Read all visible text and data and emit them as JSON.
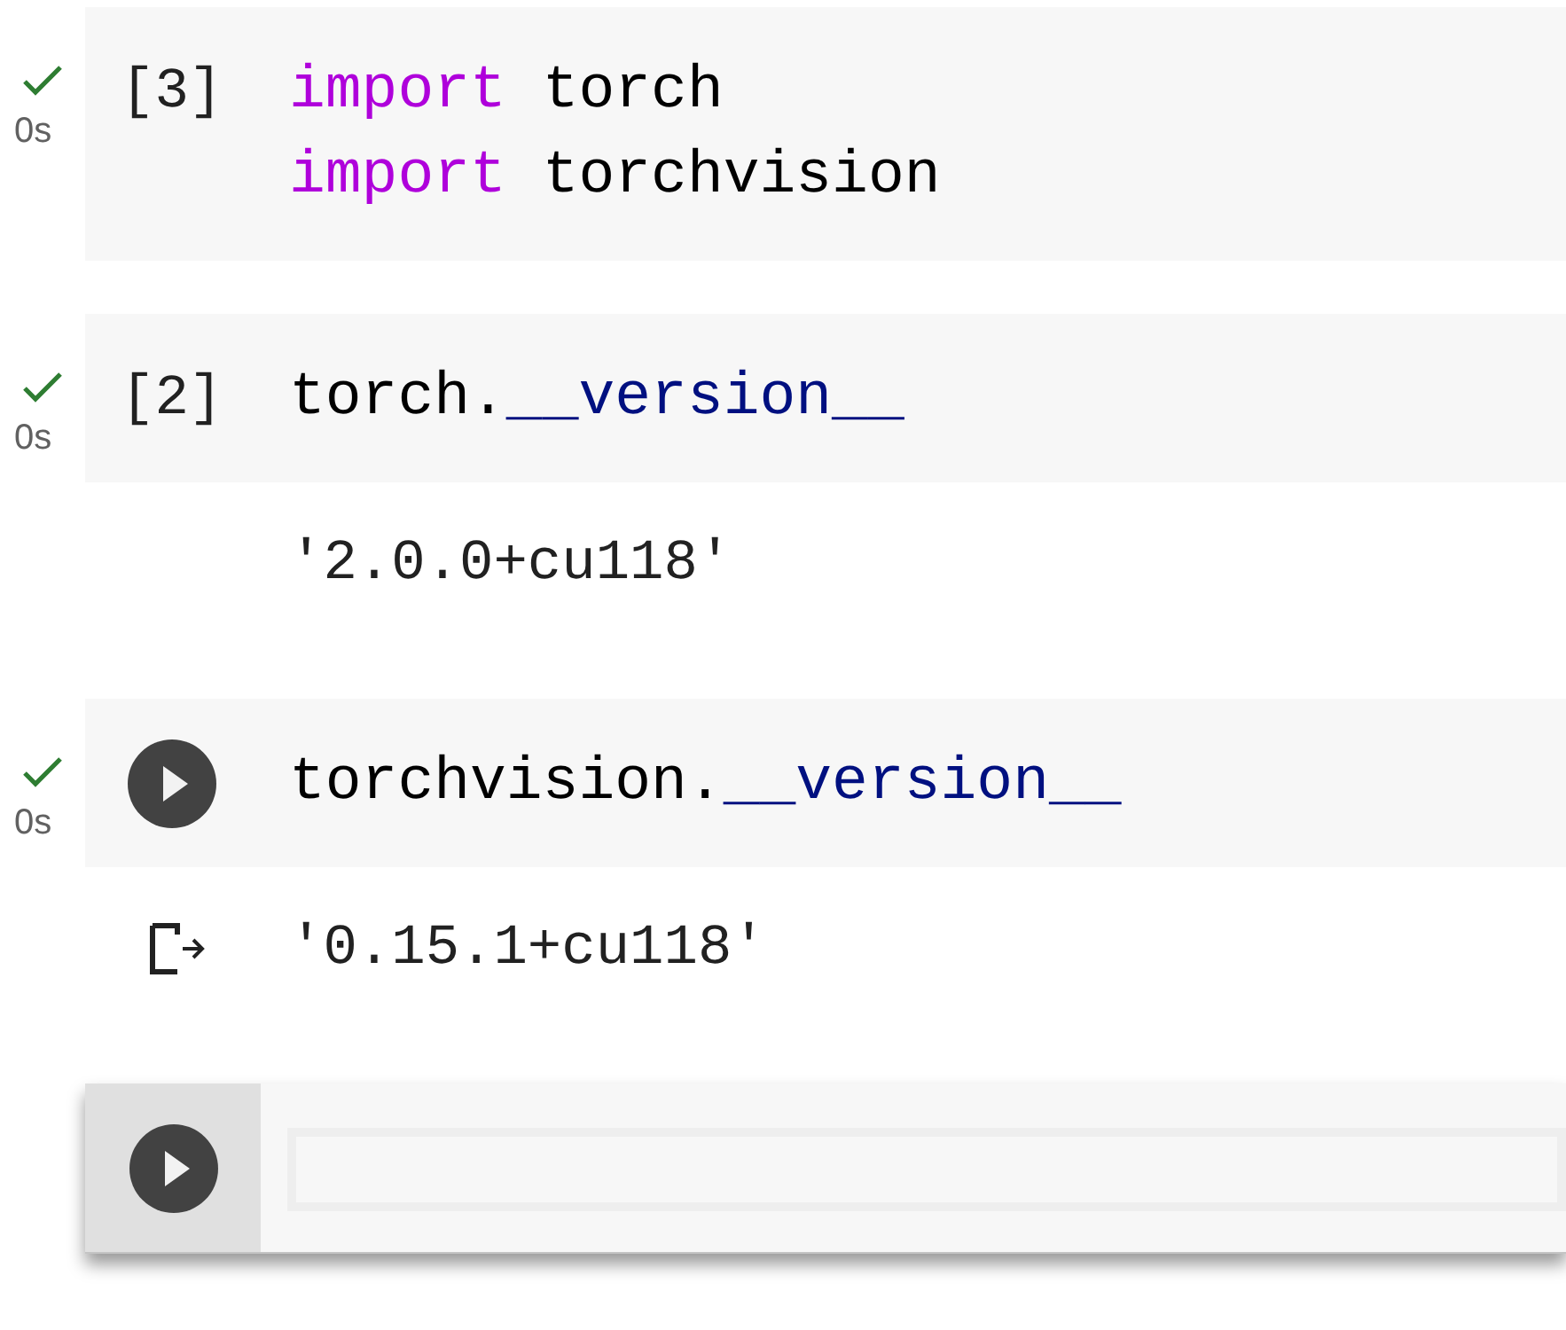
{
  "cells": [
    {
      "status": {
        "done": true,
        "time": "0s"
      },
      "kind": "prompt",
      "prompt": "[3]",
      "focused": false,
      "code": [
        [
          {
            "kind": "keyword",
            "text": "import"
          },
          {
            "kind": "plain",
            "text": " torch"
          }
        ],
        [
          {
            "kind": "keyword",
            "text": "import"
          },
          {
            "kind": "plain",
            "text": " torchvision"
          }
        ]
      ]
    },
    {
      "status": {
        "done": true,
        "time": "0s"
      },
      "kind": "prompt",
      "prompt": "[2]",
      "focused": false,
      "code": [
        [
          {
            "kind": "plain",
            "text": "torch."
          },
          {
            "kind": "attribute",
            "text": "__version__"
          }
        ]
      ],
      "output": {
        "text": "'2.0.0+cu118'",
        "icon": false
      }
    },
    {
      "status": {
        "done": true,
        "time": "0s"
      },
      "kind": "button",
      "focused": false,
      "code": [
        [
          {
            "kind": "plain",
            "text": "torchvision."
          },
          {
            "kind": "attribute",
            "text": "__version__"
          }
        ]
      ],
      "output": {
        "text": "'0.15.1+cu118'",
        "icon": true
      }
    },
    {
      "kind": "button",
      "focused": true
    }
  ]
}
